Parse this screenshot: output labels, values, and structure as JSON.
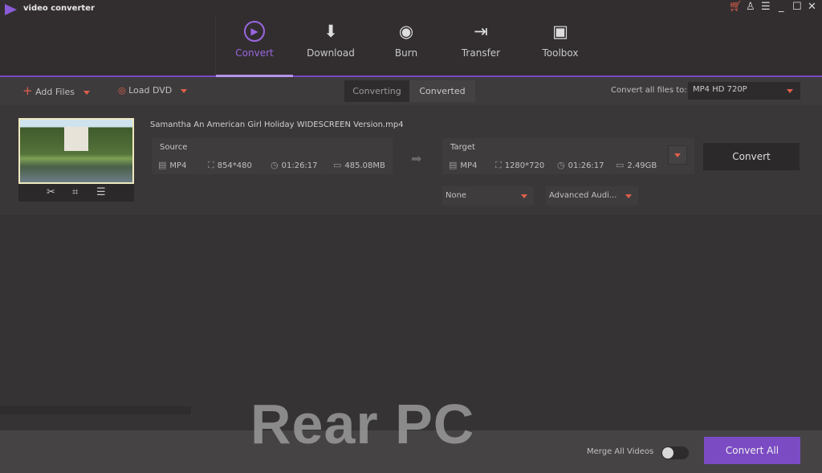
{
  "app": {
    "title": "video converter"
  },
  "window_controls": {
    "cart": "cart-icon",
    "account": "user-icon",
    "menu": "menu-icon",
    "minimize": "minimize-icon",
    "maximize": "maximize-icon",
    "close": "close-icon"
  },
  "nav": [
    {
      "label": "Convert",
      "icon": "convert-icon",
      "active": true
    },
    {
      "label": "Download",
      "icon": "download-icon"
    },
    {
      "label": "Burn",
      "icon": "burn-icon"
    },
    {
      "label": "Transfer",
      "icon": "transfer-icon"
    },
    {
      "label": "Toolbox",
      "icon": "toolbox-icon"
    }
  ],
  "toolbar": {
    "add_files": "Add Files",
    "load_dvd": "Load DVD",
    "tabs": [
      "Converting",
      "Converted"
    ],
    "convert_all_label": "Convert all files to:",
    "format": "MP4 HD 720P"
  },
  "item": {
    "filename": "Samantha An American Girl Holiday WIDESCREEN Version.mp4",
    "source": {
      "label": "Source",
      "format": "MP4",
      "resolution": "854*480",
      "duration": "01:26:17",
      "size": "485.08MB"
    },
    "target": {
      "label": "Target",
      "format": "MP4",
      "resolution": "1280*720",
      "duration": "01:26:17",
      "size": "2.49GB"
    },
    "subtitle": "None",
    "audio": "Advanced Audi...",
    "convert": "Convert"
  },
  "footer": {
    "merge_label": "Merge All Videos",
    "merge_on": false,
    "convert_all": "Convert All"
  },
  "watermark": "Rear PC",
  "colors": {
    "accent": "#7b4bc4",
    "caret": "#e0604a"
  }
}
